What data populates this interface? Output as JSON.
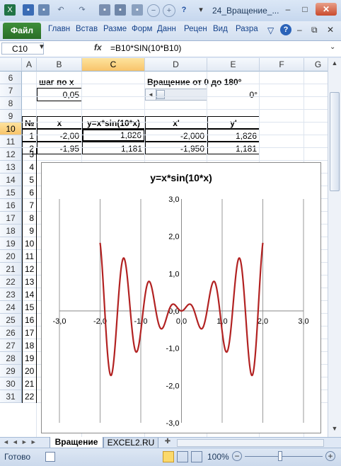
{
  "app": {
    "window_title": "24_Вращение_...",
    "file_tab": "Файл",
    "ribbon_tabs": [
      "Главн",
      "Встав",
      "Разме",
      "Форм",
      "Данн",
      "Рецен",
      "Вид",
      "Разра"
    ]
  },
  "formula_bar": {
    "name_box": "C10",
    "fx": "fx",
    "formula": "=B10*SIN(10*B10)"
  },
  "columns": [
    "A",
    "B",
    "C",
    "D",
    "E",
    "F",
    "G"
  ],
  "rows": [
    "6",
    "7",
    "8",
    "9",
    "10",
    "11",
    "12",
    "13",
    "14",
    "15",
    "16",
    "17",
    "18",
    "19",
    "20",
    "21",
    "22",
    "23",
    "24",
    "25",
    "26",
    "27",
    "28",
    "29",
    "30",
    "31"
  ],
  "cells": {
    "b6": "шаг по x",
    "b7": "0,05",
    "d6": "Вращение от 0 до 180°",
    "e7": "0°",
    "hdr_no": "№",
    "hdr_x": "x",
    "hdr_y": "y=x*sin(10*x)",
    "hdr_xp": "x'",
    "hdr_yp": "y'",
    "r10": {
      "n": "1",
      "x": "-2,00",
      "y": "1,826",
      "xp": "-2,000",
      "yp": "1,826"
    },
    "r11": {
      "n": "2",
      "x": "-1,95",
      "y": "1,181",
      "xp": "-1,950",
      "yp": "1,181"
    },
    "row_numbers": [
      "3",
      "4",
      "5",
      "6",
      "7",
      "8",
      "9",
      "10",
      "11",
      "12",
      "13",
      "14",
      "15",
      "16",
      "17",
      "18",
      "19",
      "20",
      "21",
      "22"
    ]
  },
  "sheets": {
    "active": "Вращение",
    "other": "EXCEL2.RU"
  },
  "status": {
    "ready": "Готово",
    "zoom": "100%"
  },
  "chart_data": {
    "type": "line",
    "title": "y=x*sin(10*x)",
    "function": "y = x*sin(10*x)",
    "x_range": [
      -2.0,
      2.0
    ],
    "x_step": 0.05,
    "xlim": [
      -3.0,
      3.0
    ],
    "ylim": [
      -3.0,
      3.0
    ],
    "x_ticks": [
      "-3,0",
      "-2,0",
      "-1,0",
      "0,0",
      "1,0",
      "2,0",
      "3,0"
    ],
    "y_ticks": [
      "3,0",
      "2,0",
      "1,0",
      "0,0",
      "-1,0",
      "-2,0",
      "-3,0"
    ],
    "series_color": "#b22222",
    "grid": "vertical"
  }
}
